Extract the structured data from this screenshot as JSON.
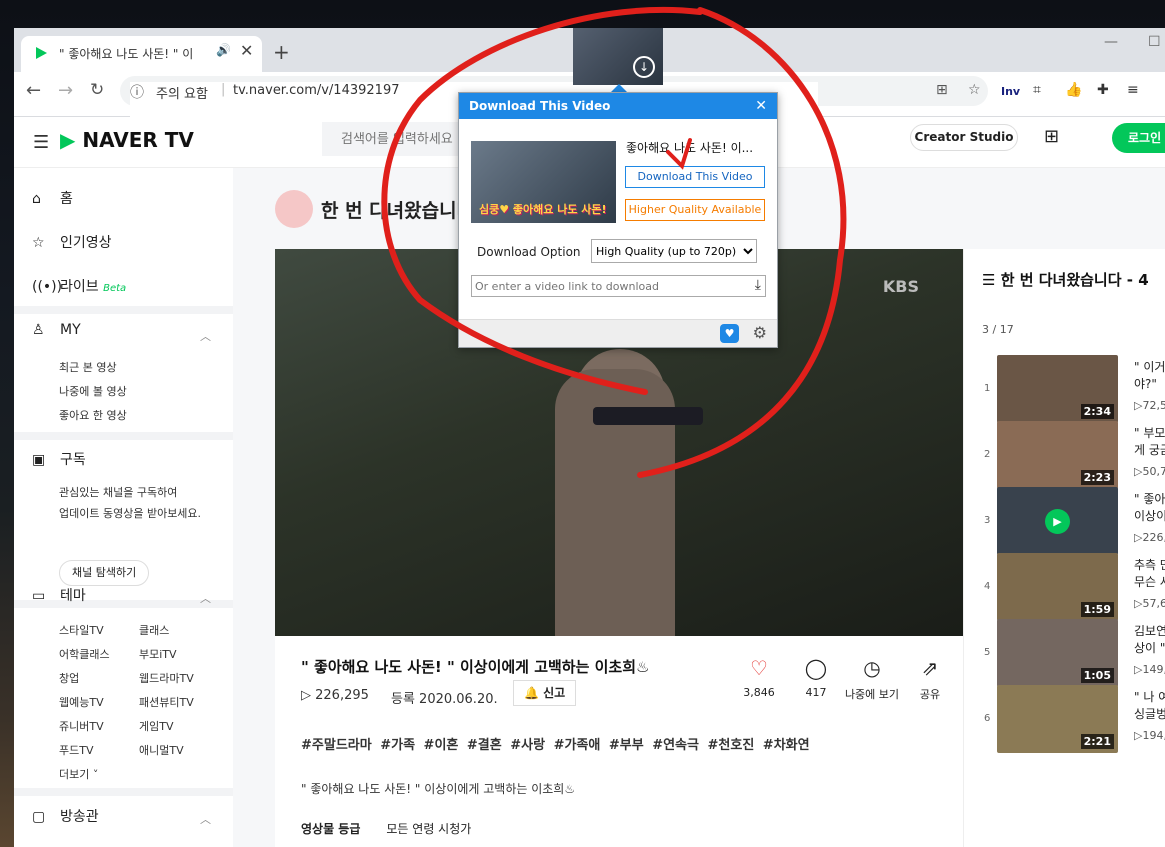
{
  "browser": {
    "tab_title": "\" 좋아해요 나도 사돈! \" 이",
    "warning": "주의 요함",
    "url": "tv.naver.com/v/14392197",
    "ext_inv": "Inv",
    "new_tab": "+",
    "close": "✕"
  },
  "header": {
    "logo": "NAVER TV",
    "search_placeholder": "검색어를 입력하세요",
    "creator_studio": "Creator Studio",
    "login": "로그인"
  },
  "sidebar": {
    "home": "홈",
    "popular": "인기영상",
    "live": "라이브",
    "live_badge": "Beta",
    "my": "MY",
    "my_items": [
      "최근 본 영상",
      "나중에 볼 영상",
      "좋아요 한 영상"
    ],
    "subscribe": "구독",
    "subscribe_desc1": "관심있는 채널을 구독하여",
    "subscribe_desc2": "업데이트 동영상을 받아보세요.",
    "explore": "채널 탐색하기",
    "theme": "테마",
    "theme_items": [
      [
        "스타일TV",
        "클래스"
      ],
      [
        "어학클래스",
        "부모iTV"
      ],
      [
        "창업",
        "웹드라마TV"
      ],
      [
        "웹예능TV",
        "패션뷰티TV"
      ],
      [
        "쥬니버TV",
        "게임TV"
      ],
      [
        "푸드TV",
        "애니멀TV"
      ]
    ],
    "more": "더보기 ˅",
    "broadcast": "방송관"
  },
  "channel": {
    "title": "한 번 다녀왔습니다"
  },
  "video": {
    "kbs": "KBS",
    "title": "\" 좋아해요 나도 사돈! \"  이상이에게 고백하는 이초희♨",
    "views": "▷ 226,295",
    "date": "등록  2020.06.20.",
    "report": "신고",
    "likes": "3,846",
    "comments": "417",
    "later": "나중에 보기",
    "share": "공유",
    "tags": "#주말드라마 #가족 #이혼 #결혼 #사랑 #가족애 #부부 #연속극 #천호진 #차화연",
    "desc": "\" 좋아해요 나도 사돈! \"  이상이에게 고백하는 이초희♨",
    "grade_label": "영상물 등급",
    "grade_value": "모든 연령 시청가"
  },
  "playlist": {
    "title": "한 번 다녀왔습니다 - 4",
    "count": "3 / 17",
    "items": [
      {
        "n": "1",
        "dur": "2:34",
        "title": "\" 이거\n야?\"",
        "views": "▷72,5"
      },
      {
        "n": "2",
        "dur": "2:23",
        "title": "\" 부모\n게 궁금",
        "views": "▷50,7"
      },
      {
        "n": "3",
        "dur": "",
        "title": "\" 좋아\n이상이",
        "views": "▷226,"
      },
      {
        "n": "4",
        "dur": "1:59",
        "title": "추측 만\n무슨 사",
        "views": "▷57,6"
      },
      {
        "n": "5",
        "dur": "1:05",
        "title": "김보연\n상이 \"",
        "views": "▷149,"
      },
      {
        "n": "6",
        "dur": "2:21",
        "title": "\" 나 여\n싱글벙",
        "views": "▷194,"
      }
    ]
  },
  "popup": {
    "header": "Download This Video",
    "video_title": "좋아해요 나도 사돈! 이...",
    "download": "Download This Video",
    "higher": "Higher Quality Available",
    "option_label": "Download Option",
    "option_value": "High Quality (up to 720p)",
    "link_placeholder": "Or enter a video link to download",
    "thumb_text": "심쿵♥ 좋아해요 나도 사돈!"
  },
  "colors": {
    "naver_green": "#03c75a",
    "popup_blue": "#1e88e5",
    "annotation_red": "#e0201b"
  }
}
